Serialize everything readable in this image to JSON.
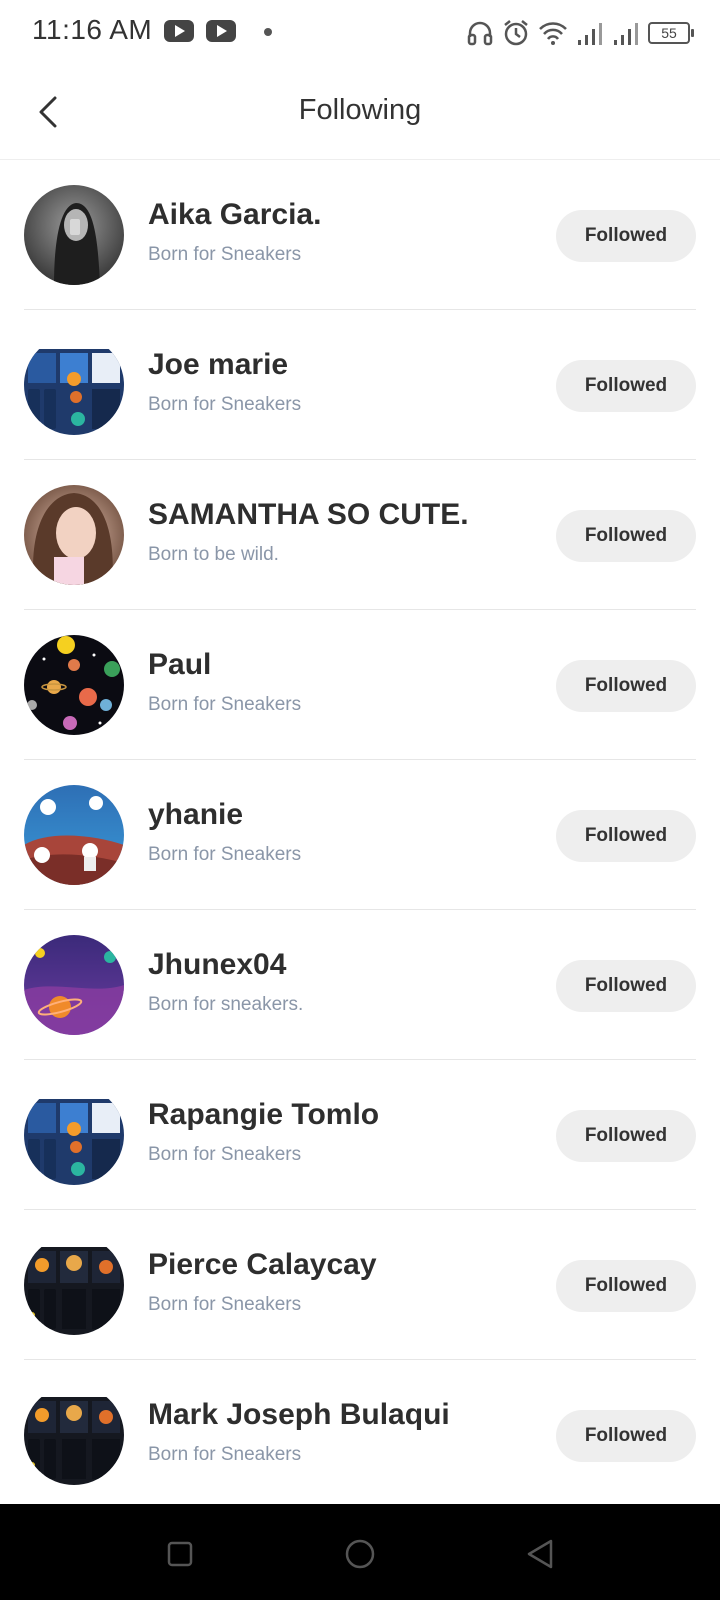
{
  "status_bar": {
    "time": "11:16 AM",
    "battery": "55",
    "icons": [
      "youtube-icon",
      "youtube-icon",
      "headphones-icon",
      "alarm-icon",
      "wifi-icon",
      "signal-icon",
      "signal-icon",
      "battery-icon"
    ]
  },
  "header": {
    "title": "Following",
    "back_icon": "chevron-left-icon"
  },
  "following": [
    {
      "name": "Aika Garcia.",
      "bio": "Born for Sneakers",
      "button": "Followed",
      "avatar": "photo-dark-hair"
    },
    {
      "name": "Joe marie",
      "bio": "Born for Sneakers",
      "button": "Followed",
      "avatar": "space-collage-blue"
    },
    {
      "name": "SAMANTHA SO CUTE.",
      "bio": "Born to be wild.",
      "button": "Followed",
      "avatar": "photo-girl"
    },
    {
      "name": "Paul",
      "bio": "Born for Sneakers",
      "button": "Followed",
      "avatar": "planets-black"
    },
    {
      "name": "yhanie",
      "bio": "Born for Sneakers",
      "button": "Followed",
      "avatar": "astronauts-blue"
    },
    {
      "name": "Jhunex04",
      "bio": "Born for sneakers.",
      "button": "Followed",
      "avatar": "planet-purple"
    },
    {
      "name": "Rapangie Tomlo",
      "bio": "Born for Sneakers",
      "button": "Followed",
      "avatar": "space-collage-blue"
    },
    {
      "name": "Pierce Calaycay",
      "bio": "Born for Sneakers",
      "button": "Followed",
      "avatar": "space-collage-dark"
    },
    {
      "name": "Mark Joseph Bulaqui",
      "bio": "Born for Sneakers",
      "button": "Followed",
      "avatar": "space-collage-dark"
    }
  ],
  "nav_bar": {
    "buttons": [
      "recents-square-icon",
      "home-circle-icon",
      "back-triangle-icon"
    ]
  },
  "colors": {
    "bio_text": "#8a96a8",
    "button_bg": "#eeeeee",
    "nav_bg": "#000000"
  }
}
